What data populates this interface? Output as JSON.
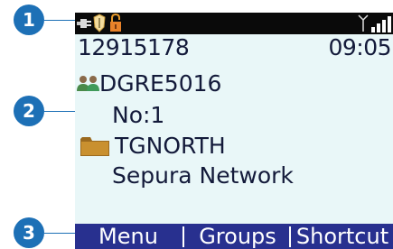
{
  "callouts": [
    "1",
    "2",
    "3"
  ],
  "status_bar": {
    "icons": [
      "plug-icon",
      "shield-icon",
      "lock-icon",
      "antenna-icon",
      "signal-bars-icon"
    ]
  },
  "identity": {
    "issi": "12915178",
    "time": "09:05"
  },
  "talkgroup": {
    "icon": "group-icon",
    "name": "DGRE5016",
    "number": "No:1"
  },
  "folder": {
    "icon": "folder-icon",
    "name": "TGNORTH",
    "network": "Sepura Network"
  },
  "softkeys": {
    "left": "Menu",
    "middle": "Groups",
    "right": "Shortcut"
  },
  "colors": {
    "screen_bg": "#e9f7f8",
    "status_bg": "#0a0a0a",
    "softkey_bg": "#28308f",
    "text": "#131a3a",
    "callout": "#1d70b6"
  }
}
